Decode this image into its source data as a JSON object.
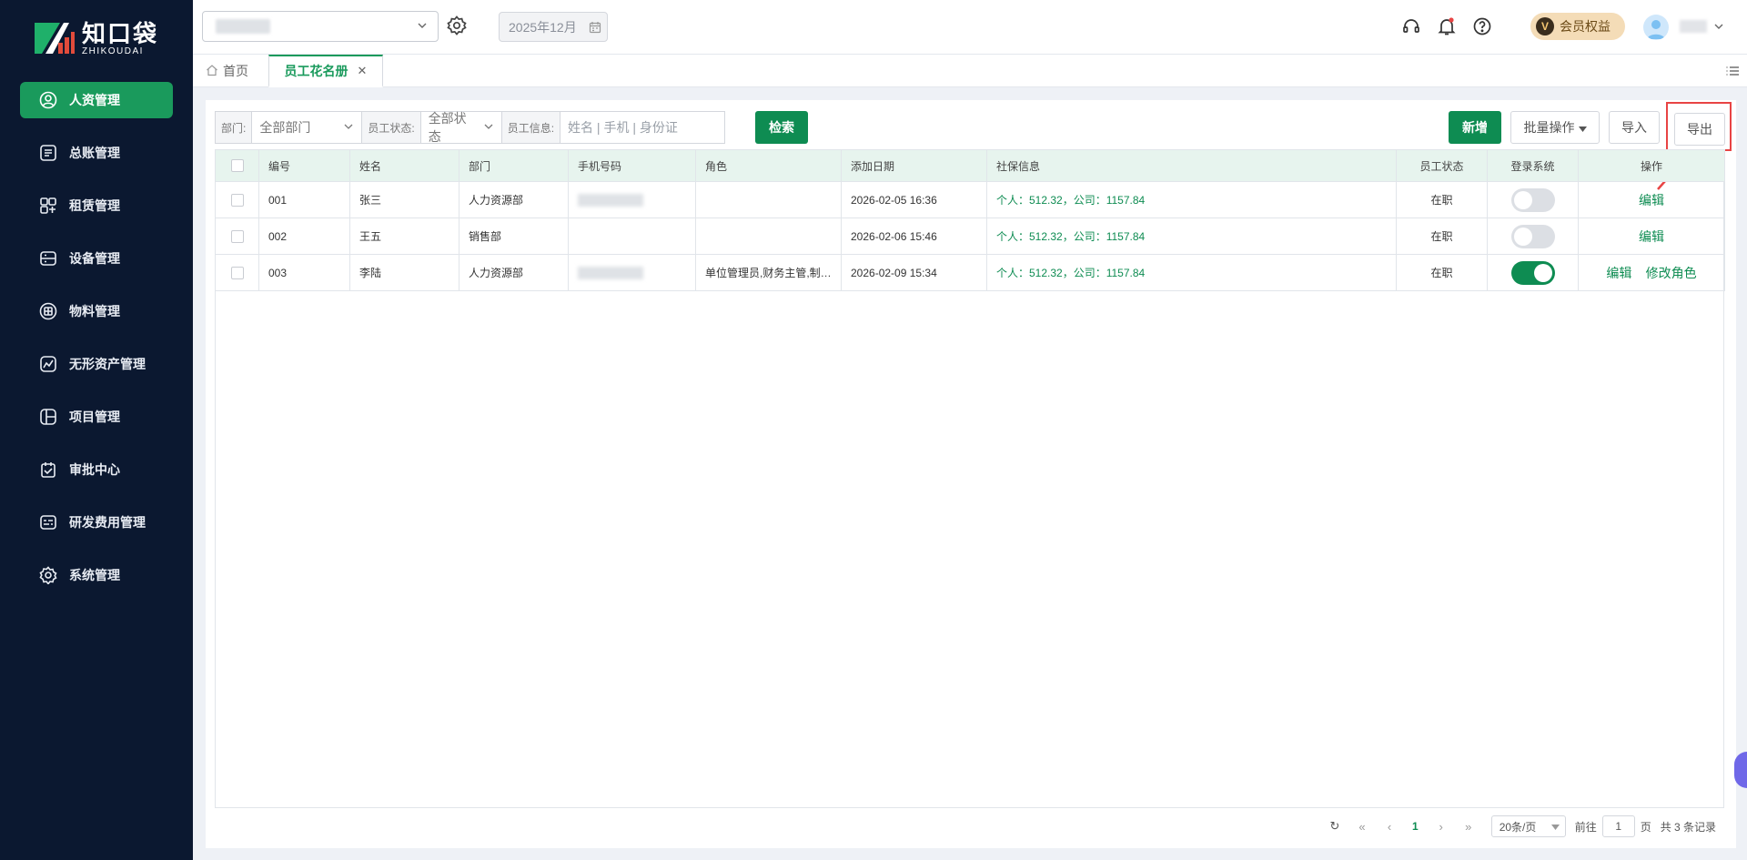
{
  "brand": {
    "name_cn": "知口袋",
    "name_en": "ZHIKOUDAI"
  },
  "sidebar": {
    "items": [
      {
        "label": "人资管理",
        "icon": "user-circle-icon",
        "active": true
      },
      {
        "label": "总账管理",
        "icon": "ledger-icon"
      },
      {
        "label": "租赁管理",
        "icon": "lease-icon"
      },
      {
        "label": "设备管理",
        "icon": "device-icon"
      },
      {
        "label": "物料管理",
        "icon": "material-icon"
      },
      {
        "label": "无形资产管理",
        "icon": "intangible-asset-icon"
      },
      {
        "label": "项目管理",
        "icon": "project-icon"
      },
      {
        "label": "审批中心",
        "icon": "approval-icon"
      },
      {
        "label": "研发费用管理",
        "icon": "rd-expense-icon"
      },
      {
        "label": "系统管理",
        "icon": "settings-icon"
      }
    ]
  },
  "topbar": {
    "date": "2025年12月",
    "vip_badge": "V",
    "vip_label": "会员权益"
  },
  "tabs": {
    "home": "首页",
    "active": "员工花名册"
  },
  "filters": {
    "dept_label": "部门:",
    "dept_value": "全部部门",
    "status_label": "员工状态:",
    "status_value": "全部状态",
    "info_label": "员工信息:",
    "info_placeholder": "姓名 | 手机 | 身份证",
    "search_btn": "检索"
  },
  "actions": {
    "add": "新增",
    "batch": "批量操作",
    "import": "导入",
    "export": "导出"
  },
  "table": {
    "headers": [
      "编号",
      "姓名",
      "部门",
      "手机号码",
      "角色",
      "添加日期",
      "社保信息",
      "员工状态",
      "登录系统",
      "操作"
    ],
    "rows": [
      {
        "id": "001",
        "name": "张三",
        "dept": "人力资源部",
        "role": "",
        "date": "2026-02-05 16:36",
        "social": "个人：512.32，公司：1157.84",
        "status": "在职",
        "login": false,
        "ops": [
          "编辑"
        ]
      },
      {
        "id": "002",
        "name": "王五",
        "dept": "销售部",
        "role": "",
        "date": "2026-02-06 15:46",
        "social": "个人：512.32，公司：1157.84",
        "status": "在职",
        "login": false,
        "ops": [
          "编辑"
        ]
      },
      {
        "id": "003",
        "name": "李陆",
        "dept": "人力资源部",
        "role": "单位管理员,财务主管,制…",
        "date": "2026-02-09 15:34",
        "social": "个人：512.32，公司：1157.84",
        "status": "在职",
        "login": true,
        "ops": [
          "编辑",
          "修改角色"
        ]
      }
    ]
  },
  "pagination": {
    "current": "1",
    "page_size": "20条/页",
    "goto_label": "前往",
    "goto_value": "1",
    "page_unit": "页",
    "total": "共 3 条记录"
  },
  "colors": {
    "sidebar_bg": "#0b1830",
    "accent": "#0e8c52",
    "active_nav": "#1a9a5c",
    "highlight": "#e84444"
  }
}
